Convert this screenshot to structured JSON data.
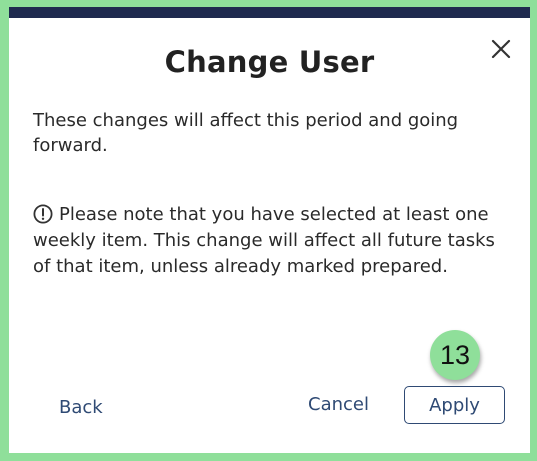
{
  "dialog": {
    "title": "Change User",
    "message": "These changes will affect this period and going forward.",
    "note": "Please note that you have selected at least one weekly item. This change will affect all future tasks of that item, unless already marked prepared.",
    "note_icon": "info-circle-icon",
    "close_icon": "close-icon"
  },
  "step_badge": "13",
  "actions": {
    "back_label": "Back",
    "cancel_label": "Cancel",
    "apply_label": "Apply"
  },
  "colors": {
    "outer_highlight": "#8fdf9a",
    "top_bar": "#1f2a4f",
    "link": "#2f4a74"
  }
}
